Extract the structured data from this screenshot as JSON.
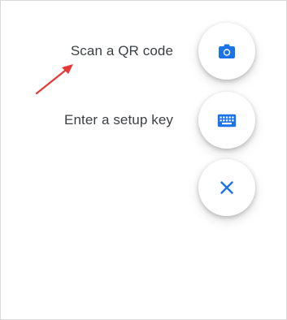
{
  "actions": {
    "scan_qr_label": "Scan a QR code",
    "setup_key_label": "Enter a setup key"
  },
  "icons": {
    "scan": "camera-icon",
    "setup_key": "keyboard-icon",
    "close": "close-icon"
  },
  "colors": {
    "accent": "#1a73e8",
    "label_text": "#3c4043",
    "annotation_arrow": "#e53935"
  }
}
